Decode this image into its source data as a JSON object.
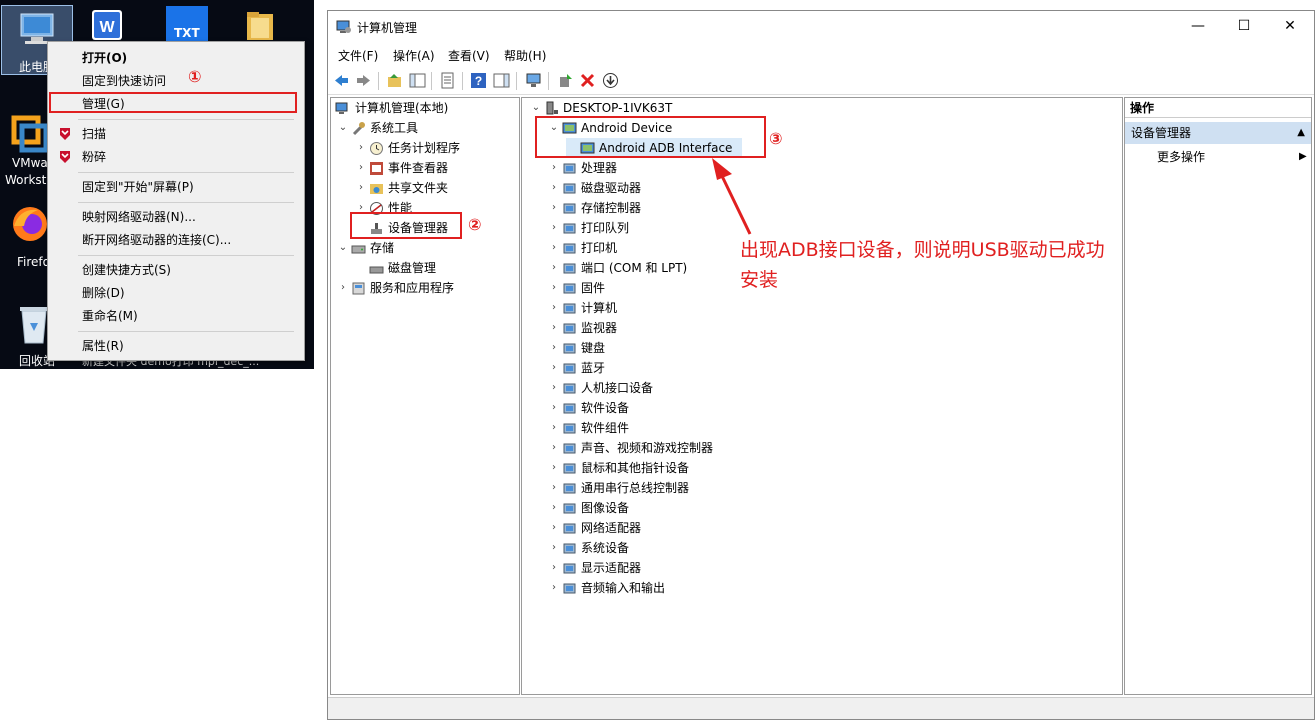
{
  "desktop": {
    "icons": [
      {
        "label": "此电脑",
        "icon": "computer-icon"
      },
      {
        "label": "VMware Workstation",
        "icon": "vmware-icon"
      },
      {
        "label": "Firefox",
        "icon": "firefox-icon"
      },
      {
        "label": "回收站",
        "icon": "recycle-bin-icon"
      }
    ],
    "top_icons": [
      {
        "label": "",
        "icon": "wps-writer-icon"
      },
      {
        "label": "TXT",
        "icon": "txt-file-icon"
      },
      {
        "label": "",
        "icon": "folder-icon"
      }
    ],
    "vm_label_1": "VMwa",
    "vm_label_2": "Workst",
    "ff_label": "Firefo",
    "pc_label": "此电脑",
    "bin_label": "回收站",
    "bottom_text": "新建文件夹    demo打印    mpi_dec_..."
  },
  "context_menu": {
    "items": [
      {
        "label": "打开(O)",
        "bold": true
      },
      {
        "label": "固定到快速访问"
      },
      {
        "label": "管理(G)"
      },
      {
        "label": "扫描",
        "icon": "mcafee-icon"
      },
      {
        "label": "粉碎",
        "icon": "mcafee-icon"
      },
      {
        "label": "固定到\"开始\"屏幕(P)"
      },
      {
        "label": "映射网络驱动器(N)..."
      },
      {
        "label": "断开网络驱动器的连接(C)..."
      },
      {
        "label": "创建快捷方式(S)"
      },
      {
        "label": "删除(D)"
      },
      {
        "label": "重命名(M)"
      },
      {
        "label": "属性(R)"
      }
    ]
  },
  "annotations": {
    "step1": "①",
    "step2": "②",
    "step3": "③",
    "note": "出现ADB接口设备，则说明USB驱动已成功安装",
    "color": "#e02020"
  },
  "window": {
    "title": "计算机管理",
    "minimize": "—",
    "maximize": "☐",
    "close": "✕",
    "menu": [
      "文件(F)",
      "操作(A)",
      "查看(V)",
      "帮助(H)"
    ]
  },
  "left_tree": {
    "root": "计算机管理(本地)",
    "system_tools": "系统工具",
    "task_scheduler": "任务计划程序",
    "event_viewer": "事件查看器",
    "shared_folders": "共享文件夹",
    "performance": "性能",
    "device_manager": "设备管理器",
    "storage": "存储",
    "disk_management": "磁盘管理",
    "services_apps": "服务和应用程序"
  },
  "device_tree": {
    "computer": "DESKTOP-1IVK63T",
    "android_device": "Android Device",
    "adb_interface": "Android ADB Interface",
    "categories": [
      "处理器",
      "磁盘驱动器",
      "存储控制器",
      "打印队列",
      "打印机",
      "端口 (COM 和 LPT)",
      "固件",
      "计算机",
      "监视器",
      "键盘",
      "蓝牙",
      "人机接口设备",
      "软件设备",
      "软件组件",
      "声音、视频和游戏控制器",
      "鼠标和其他指针设备",
      "通用串行总线控制器",
      "图像设备",
      "网络适配器",
      "系统设备",
      "显示适配器",
      "音频输入和输出"
    ]
  },
  "actions_pane": {
    "header": "操作",
    "selected": "设备管理器",
    "more": "更多操作"
  }
}
